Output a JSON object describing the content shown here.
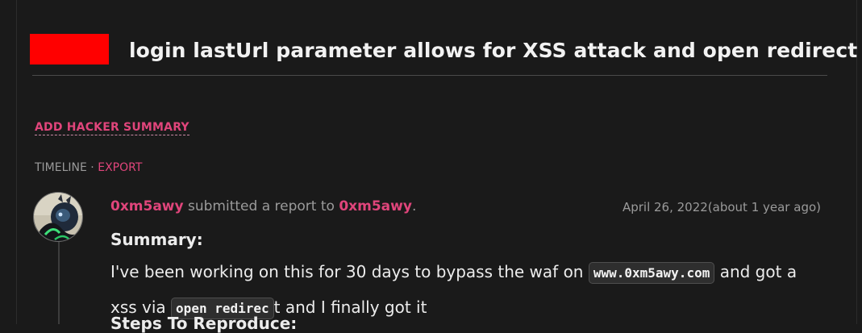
{
  "report": {
    "title": "login lastUrl parameter allows for XSS attack and open redirect",
    "redaction_color": "#ff0000"
  },
  "actions": {
    "add_summary_label": "ADD HACKER SUMMARY"
  },
  "timeline": {
    "label": "TIMELINE",
    "separator": " · ",
    "export_label": "EXPORT"
  },
  "event": {
    "actor": "0xm5awy",
    "action_text": " submitted a report to ",
    "target": "0xm5awy",
    "trailing": ".",
    "date": "April 26, 2022(about 1 year ago)",
    "avatar_icon": "hacker-avatar-icon"
  },
  "content": {
    "summary_heading": "Summary:",
    "para_part1": "I've been working on this for 30 days to bypass the waf on ",
    "code_domain": "www.0xm5awy.com",
    "para_part2": " and got a xss via ",
    "code_redirect": "open redirec",
    "para_part3": "t and I finally got it",
    "next_heading": "Steps To Reproduce:"
  },
  "colors": {
    "background": "#1a1a1a",
    "accent": "#e0457b",
    "muted": "#9a9a9a",
    "text": "#ececec"
  }
}
